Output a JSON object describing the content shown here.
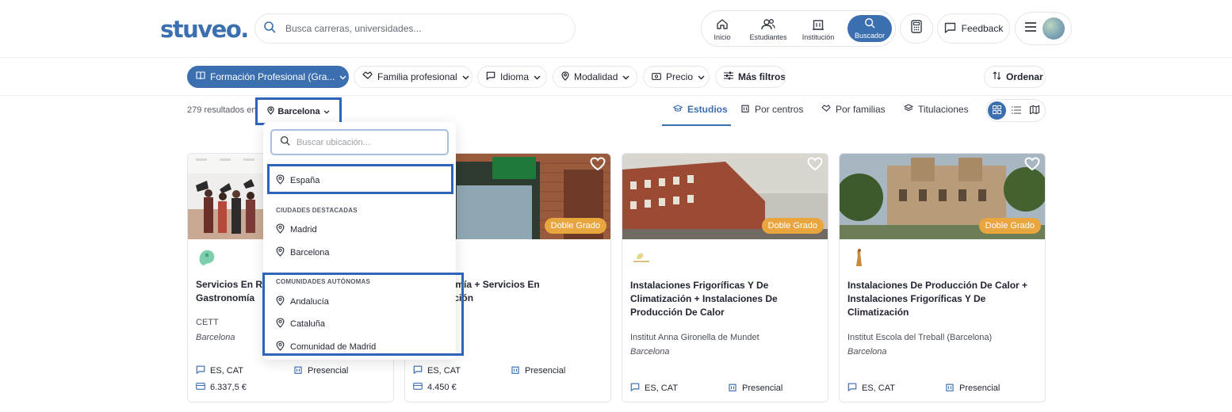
{
  "header": {
    "logo": "stuveo.",
    "search_placeholder": "Busca carreras, universidades...",
    "nav": [
      {
        "label": "Inicio",
        "icon": "home-icon"
      },
      {
        "label": "Estudiantes",
        "icon": "users-icon"
      },
      {
        "label": "Institución",
        "icon": "institution-icon"
      },
      {
        "label": "Buscador",
        "icon": "search-icon",
        "active": true
      }
    ],
    "feedback_label": "Feedback"
  },
  "filters": [
    {
      "label": "Formación Profesional (Gra...",
      "icon": "book-icon",
      "primary": true
    },
    {
      "label": "Familia profesional",
      "icon": "handshake-icon"
    },
    {
      "label": "Idioma",
      "icon": "chat-icon"
    },
    {
      "label": "Modalidad",
      "icon": "pin-icon"
    },
    {
      "label": "Precio",
      "icon": "cash-icon"
    },
    {
      "label": "Más filtros",
      "icon": "sliders-icon"
    }
  ],
  "sort_label": "Ordenar",
  "results": {
    "count_text": "279 resultados en",
    "location": "Barcelona"
  },
  "tabs": [
    {
      "label": "Estudios",
      "active": true
    },
    {
      "label": "Por centros"
    },
    {
      "label": "Por familias"
    },
    {
      "label": "Titulaciones"
    }
  ],
  "dropdown": {
    "search_placeholder": "Buscar ubicación...",
    "top_item": "España",
    "section_cities": "CIUDADES DESTACADAS",
    "cities": [
      "Madrid",
      "Barcelona"
    ],
    "section_regions": "COMUNIDADES AUTÓNOMAS",
    "regions": [
      "Andalucía",
      "Cataluña",
      "Comunidad de Madrid"
    ]
  },
  "cards": [
    {
      "title": "Servicios En Restauración +\nGastronomía",
      "institution": "CETT",
      "city": "Barcelona",
      "languages": "ES, CAT",
      "modality": "Presencial",
      "price": "6.337,5 €",
      "badge": ""
    },
    {
      "title": "Gastronomía + Servicios En\nRestauración",
      "institution": "",
      "city": "",
      "languages": "ES, CAT",
      "modality": "Presencial",
      "price": "4.450 €",
      "badge": "Doble Grado"
    },
    {
      "title": "Instalaciones Frigoríficas Y De Climatización + Instalaciones De Producción De Calor",
      "institution": "Institut Anna Gironella de Mundet",
      "city": "Barcelona",
      "languages": "ES, CAT",
      "modality": "Presencial",
      "price": "",
      "badge": "Doble Grado"
    },
    {
      "title": "Instalaciones De Producción De Calor + Instalaciones Frigoríficas Y De Climatización",
      "institution": "Institut Escola del Treball (Barcelona)",
      "city": "Barcelona",
      "languages": "ES, CAT",
      "modality": "Presencial",
      "price": "",
      "badge": "Doble Grado"
    }
  ],
  "colors": {
    "brand": "#3b6fb0",
    "badge": "#e9a63e",
    "highlight": "#2f64b8"
  }
}
